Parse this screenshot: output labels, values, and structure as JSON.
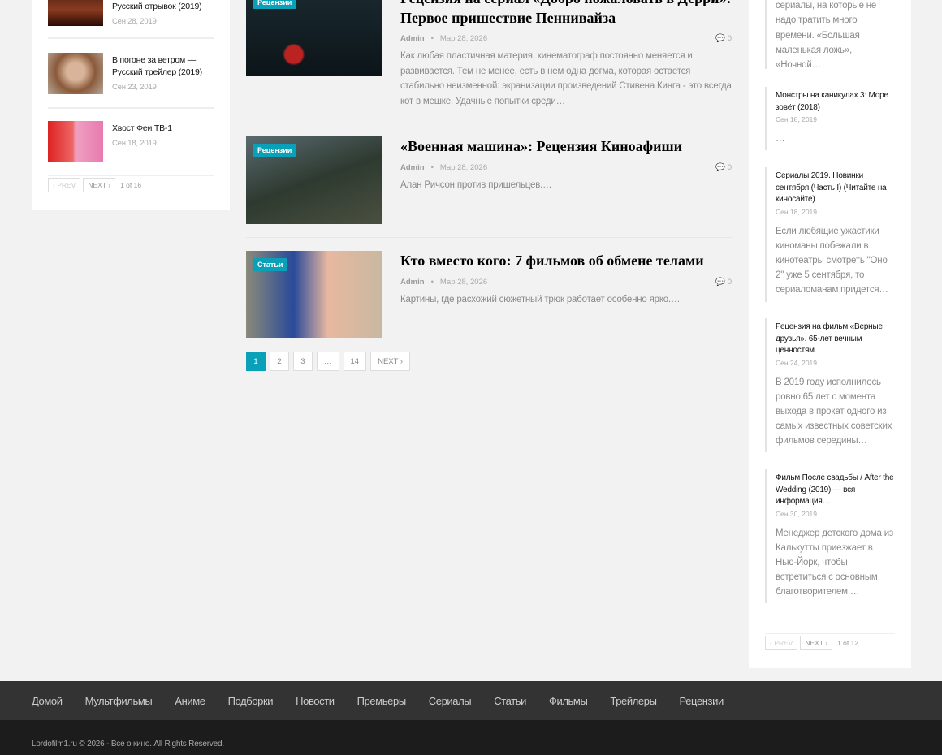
{
  "left_widget": {
    "posts": [
      {
        "title": "Русский отрывок (2019)",
        "date": "Сен 28, 2019"
      },
      {
        "title": "В погоне за ветром — Русский трейлер (2019)",
        "date": "Сен 23, 2019"
      },
      {
        "title": "Хвост Феи ТВ-1",
        "date": "Сен 18, 2019"
      }
    ],
    "prev": "‹ PREV",
    "next": "NEXT ›",
    "page_info": "1 of 16"
  },
  "posts": [
    {
      "category": "Рецензии",
      "title": "Рецензия на сериал «Добро пожаловать в Дерри»: Первое пришествие Пеннивайза",
      "author": "Admin",
      "date": "Мар 28, 2026",
      "comments": "0",
      "excerpt": "Как любая пластичная материя, кинематограф постоянно меняется и развивается. Тем не менее, есть в нем одна догма, которая остается стабильно неизменной: экранизации произведений Стивена Кинга - это всегда кот в мешке. Удачные попытки среди…"
    },
    {
      "category": "Рецензии",
      "title": "«Военная машина»: Рецензия Киноафиши",
      "author": "Admin",
      "date": "Мар 28, 2026",
      "comments": "0",
      "excerpt": "Алан Ричсон против пришельцев.…"
    },
    {
      "category": "Статьи",
      "title": "Кто вместо кого: 7 фильмов об обмене телами",
      "author": "Admin",
      "date": "Мар 28, 2026",
      "comments": "0",
      "excerpt": "Картины, где расхожий сюжетный трюк работает особенно ярко.…"
    }
  ],
  "pagination": {
    "pages": [
      "1",
      "2",
      "3",
      "…",
      "14"
    ],
    "next": "NEXT ›"
  },
  "right_widget": {
    "items": [
      {
        "excerpt": "Мы обожаем короткие сериалы, на которые не надо тратить много времени. «Большая маленькая ложь», «Ночной…"
      },
      {
        "title": "Монстры на каникулах 3: Море зовёт (2018)",
        "date": "Сен 18, 2019",
        "excerpt": "…"
      },
      {
        "title": "Сериалы 2019. Новинки сентября (Часть I) (Читайте на киносайте)",
        "date": "Сен 18, 2019",
        "excerpt": "Если любящие ужастики киноманы побежали в кинотеатры смотреть \"Оно 2\" уже 5 сентября, то сериаломанам придется…"
      },
      {
        "title": "Рецензия на фильм «Верные друзья». 65-лет вечным ценностям",
        "date": "Сен 24, 2019",
        "excerpt": "В 2019 году исполнилось ровно 65 лет с момента выхода в прокат одного из самых известных советских фильмов середины…"
      },
      {
        "title": "Фильм После свадьбы / After the Wedding (2019) — вся информация…",
        "date": "Сен 30, 2019",
        "excerpt": "Менеджер детского дома из Калькутты приезжает в Нью-Йорк, чтобы встретиться с основным благотворителем.…"
      }
    ],
    "prev": "‹ PREV",
    "next": "NEXT ›",
    "page_info": "1 of 12"
  },
  "footer_nav": [
    "Домой",
    "Мультфильмы",
    "Аниме",
    "Подборки",
    "Новости",
    "Премьеры",
    "Сериалы",
    "Статьи",
    "Фильмы",
    "Трейлеры",
    "Рецензии"
  ],
  "copyright": "Lordofilm1.ru © 2026 - Все о кино. All Rights Reserved.",
  "colors": {
    "accent": "#0aa0b8"
  }
}
